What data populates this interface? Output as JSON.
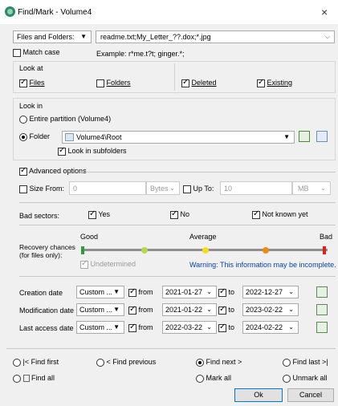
{
  "window": {
    "title": "Find/Mark - Volume4",
    "close": "×"
  },
  "search": {
    "scope_value": "Files and Folders:",
    "pattern_value": "readme.txt;My_Letter_??.dox;*.jpg",
    "match_case_label": "Match case",
    "example": "Example: r*me.t?t; ginger.*;"
  },
  "look_at": {
    "title": "Look at",
    "files": "Files",
    "folders": "Folders",
    "deleted": "Deleted",
    "existing": "Existing"
  },
  "look_in": {
    "title": "Look in",
    "entire": "Entire partition (Volume4)",
    "folder_label": "Folder",
    "folder_value": "Volume4\\Root",
    "subfolders": "Look in subfolders"
  },
  "advanced": {
    "label": "Advanced options",
    "size_from": "Size From:",
    "size_from_value": "0",
    "size_from_unit": "Bytes",
    "up_to": "Up To:",
    "up_to_value": "10",
    "up_to_unit": "MB"
  },
  "bad_sectors": {
    "label": "Bad sectors:",
    "yes": "Yes",
    "no": "No",
    "unknown": "Not known yet"
  },
  "recovery": {
    "label": "Recovery chances\n(for files only):",
    "good": "Good",
    "average": "Average",
    "bad": "Bad",
    "undetermined": "Undetermined",
    "warning": "Warning: This information may be incomplete.",
    "colors": {
      "good": "#2e9e3c",
      "light": "#b7d84a",
      "mid": "#f0e020",
      "orange": "#f08a10",
      "bad": "#e02020"
    }
  },
  "dates": [
    {
      "label": "Creation date",
      "mode": "Custom ...",
      "from_label": "from",
      "from": "2021-01-27",
      "to_label": "to",
      "to": "2022-12-27"
    },
    {
      "label": "Modification date",
      "mode": "Custom ...",
      "from_label": "from",
      "from": "2021-01-22",
      "to_label": "to",
      "to": "2023-02-22"
    },
    {
      "label": "Last access date",
      "mode": "Custom ...",
      "from_label": "from",
      "from": "2022-03-22",
      "to_label": "to",
      "to": "2024-02-22"
    }
  ],
  "actions": {
    "find_first": "|<  Find first",
    "find_prev": "<  Find previous",
    "find_next": "Find next  >",
    "find_last": "Find last  >|",
    "find_all": "Find all",
    "mark_all": "Mark all",
    "unmark_all": "Unmark all",
    "ok": "Ok",
    "cancel": "Cancel"
  }
}
